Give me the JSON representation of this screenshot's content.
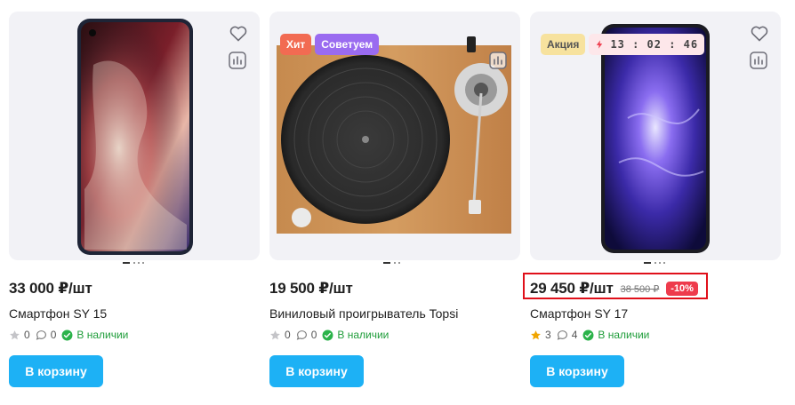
{
  "products": [
    {
      "price": "33 000 ₽/шт",
      "name": "Смартфон SY 15",
      "rating": "0",
      "reviews": "0",
      "stock": "В наличии",
      "cart_label": "В корзину",
      "image": "smartphone-sy15"
    },
    {
      "price": "19 500 ₽/шт",
      "name": "Виниловый проигрыватель Topsi",
      "rating": "0",
      "reviews": "0",
      "stock": "В наличии",
      "cart_label": "В корзину",
      "badges": [
        "Хит",
        "Советуем"
      ],
      "image": "turntable"
    },
    {
      "price": "29 450 ₽/шт",
      "old_price": "38 500 ₽",
      "discount": "-10%",
      "name": "Смартфон SY 17",
      "rating": "3",
      "reviews": "4",
      "stock": "В наличии",
      "cart_label": "В корзину",
      "badges": [
        "Акция"
      ],
      "timer": "13 : 02 : 46",
      "image": "smartphone-sy17"
    }
  ],
  "colors": {
    "accent": "#1db1f5",
    "stock_green": "#1f9d3a",
    "discount_red": "#ee3b4c",
    "badge_hit": "#f26b52",
    "badge_advise": "#9a6bf0",
    "badge_sale": "#f7e29e",
    "star_active": "#f0a500",
    "highlight_border": "#e0101a"
  },
  "icons": {
    "favorite": "heart-icon",
    "compare": "compare-chart-icon",
    "rating": "star-icon",
    "reviews": "comment-icon",
    "stock": "check-circle-icon",
    "timer": "lightning-icon"
  }
}
